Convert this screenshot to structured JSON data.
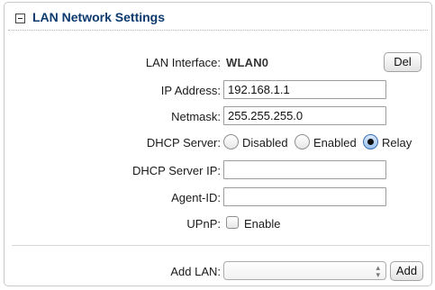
{
  "section": {
    "title": "LAN Network Settings"
  },
  "fields": {
    "lan_interface_label": "LAN Interface:",
    "lan_interface_value": "WLAN0",
    "del_button": "Del",
    "ip_address_label": "IP Address:",
    "ip_address_value": "192.168.1.1",
    "netmask_label": "Netmask:",
    "netmask_value": "255.255.255.0",
    "dhcp_server_label": "DHCP Server:",
    "dhcp_options": [
      "Disabled",
      "Enabled",
      "Relay"
    ],
    "dhcp_selected": "Relay",
    "dhcp_server_ip_label": "DHCP Server IP:",
    "dhcp_server_ip_value": "",
    "agent_id_label": "Agent-ID:",
    "agent_id_value": "",
    "upnp_label": "UPnP:",
    "upnp_option": "Enable",
    "upnp_checked": false
  },
  "add_lan": {
    "label": "Add LAN:",
    "selected": "",
    "button": "Add"
  }
}
